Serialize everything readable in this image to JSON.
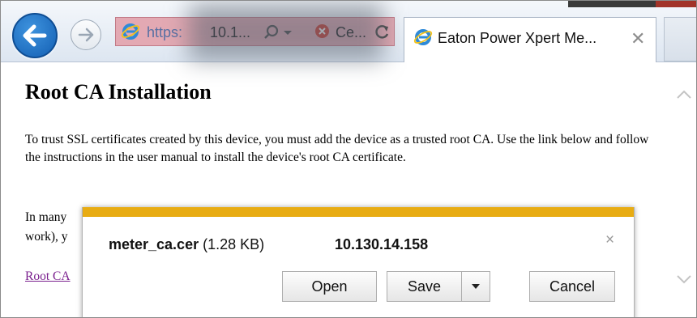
{
  "browser": {
    "address_bar": {
      "url_prefix": "https:",
      "ip_truncated": "10.1...",
      "cert_error_truncated": "Ce..."
    },
    "tab": {
      "title": "Eaton Power Xpert Me...",
      "close": "✕"
    }
  },
  "page": {
    "title": "Root CA Installation",
    "para1": "To trust SSL certificates created by this device, you must add the device as a trusted root CA. Use the link below and follow the instructions in the user manual to install the device's root CA certificate.",
    "para2_line1": "In many",
    "para2_line2": "work), y",
    "link_text": "Root CA"
  },
  "download_bar": {
    "filename": "meter_ca.cer",
    "filesize": "(1.28 KB)",
    "host": "10.130.14.158",
    "close": "×",
    "open_label": "Open",
    "save_label": "Save",
    "cancel_label": "Cancel"
  },
  "colors": {
    "download_accent": "#e8ac13",
    "address_bar_error": "#e3a9b3",
    "link": "#7a1f8e"
  }
}
